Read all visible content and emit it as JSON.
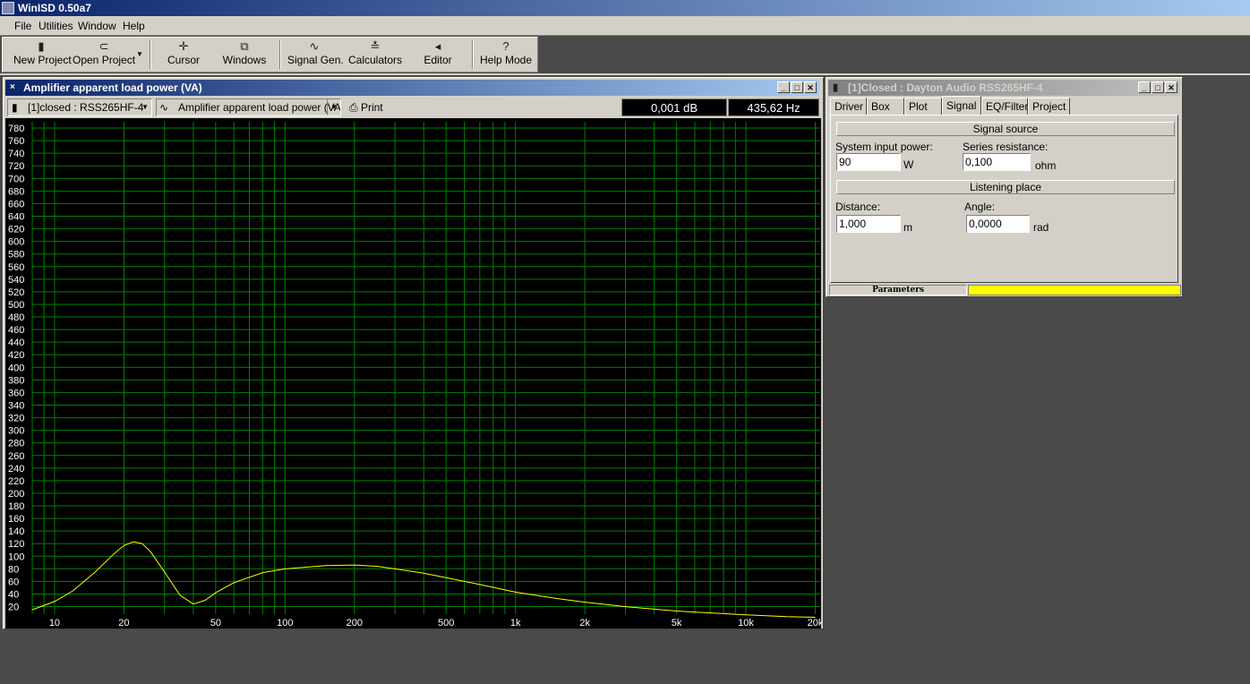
{
  "app": {
    "title": "WinISD 0.50a7"
  },
  "menu": [
    "File",
    "Utilities",
    "Window",
    "Help"
  ],
  "toolbar": {
    "new_project": "New Project",
    "open_project": "Open Project",
    "cursor": "Cursor",
    "windows": "Windows",
    "signal_gen": "Signal Gen.",
    "calculators": "Calculators",
    "editor": "Editor",
    "help_mode": "Help Mode"
  },
  "plot_window": {
    "title": "Amplifier apparent load power (VA)",
    "project_select": "[1]closed : RSS265HF-4",
    "graph_select": "Amplifier apparent load power (VA)",
    "print": "Print",
    "readout_db": "0,001 dB",
    "readout_hz": "435,62 Hz"
  },
  "params_window": {
    "title": "[1]Closed : Dayton Audio RSS265HF-4",
    "tabs": [
      "Driver",
      "Box",
      "Plot",
      "Signal",
      "EQ/Filter",
      "Project"
    ],
    "active_tab": "Signal",
    "signal_source": "Signal source",
    "system_input_power_label": "System input power:",
    "system_input_power": "90",
    "power_unit": "W",
    "series_resistance_label": "Series resistance:",
    "series_resistance": "0,100",
    "resistance_unit": "ohm",
    "listening_place": "Listening place",
    "distance_label": "Distance:",
    "distance": "1,000",
    "distance_unit": "m",
    "angle_label": "Angle:",
    "angle": "0,0000",
    "angle_unit": "rad",
    "status": "Parameters",
    "status_color": "#ffff00"
  },
  "chart_data": {
    "type": "line",
    "title": "",
    "xlabel": "",
    "ylabel": "",
    "x_scale": "log",
    "xlim": [
      8,
      21000
    ],
    "ylim": [
      8,
      790
    ],
    "x_ticks": [
      10,
      20,
      50,
      100,
      200,
      500,
      1000,
      2000,
      5000,
      10000,
      20000
    ],
    "x_tick_labels": [
      "10",
      "20",
      "50",
      "100",
      "200",
      "500",
      "1k",
      "2k",
      "5k",
      "10k",
      "20k"
    ],
    "y_ticks": [
      20,
      40,
      60,
      80,
      100,
      120,
      140,
      160,
      180,
      200,
      220,
      240,
      260,
      280,
      300,
      320,
      340,
      360,
      380,
      400,
      420,
      440,
      460,
      480,
      500,
      520,
      540,
      560,
      580,
      600,
      620,
      640,
      660,
      680,
      700,
      720,
      740,
      760,
      780
    ],
    "grid": true,
    "colors": {
      "background": "#000000",
      "grid": "#008000",
      "curve": "#ffff00",
      "labels": "#ffffff"
    },
    "series": [
      {
        "x": [
          8,
          10,
          12,
          15,
          18,
          20,
          22,
          24,
          26,
          30,
          35,
          40,
          45,
          50,
          60,
          80,
          100,
          150,
          200,
          250,
          300,
          400,
          500,
          700,
          1000,
          1500,
          2000,
          3000,
          5000,
          7000,
          10000,
          15000,
          20000
        ],
        "values": [
          15,
          28,
          45,
          75,
          103,
          117,
          123,
          120,
          108,
          75,
          38,
          24,
          30,
          42,
          58,
          74,
          80,
          85,
          86,
          84,
          80,
          73,
          66,
          55,
          43,
          33,
          27,
          20,
          13,
          10,
          7,
          4,
          3
        ]
      }
    ]
  }
}
